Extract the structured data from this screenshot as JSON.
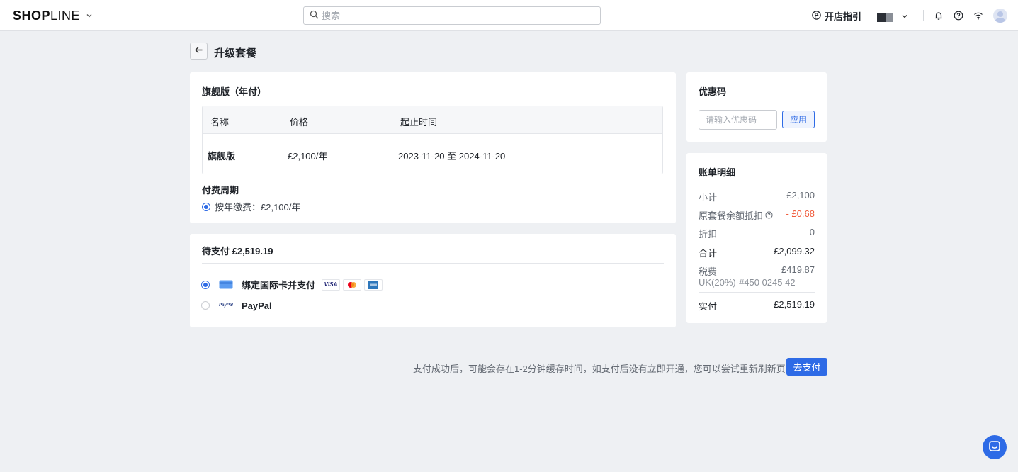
{
  "header": {
    "logo_bold_1": "SH",
    "logo_bold_2": "OP",
    "logo_thin": "LINE",
    "search_placeholder": "搜索",
    "guide_label": "开店指引"
  },
  "page": {
    "title": "升级套餐"
  },
  "plan": {
    "title": "旗舰版（年付）",
    "columns": [
      "名称",
      "价格",
      "起止时间"
    ],
    "row": {
      "name": "旗舰版",
      "price": "£2,100/年",
      "period": "2023-11-20 至 2024-11-20"
    },
    "cycle_title": "付费周期",
    "cycle_option": "按年缴费：£2,100/年"
  },
  "payment": {
    "title": "待支付 £2,519.19",
    "methods": [
      {
        "label": "绑定国际卡并支付",
        "selected": true
      },
      {
        "label": "PayPal",
        "selected": false
      }
    ],
    "card_brands": [
      "VISA",
      "mastercard",
      "amex"
    ],
    "paypal_logo": "PayPal"
  },
  "coupon": {
    "title": "优惠码",
    "placeholder": "请输入优惠码",
    "apply_label": "应用"
  },
  "bill": {
    "title": "账单明细",
    "rows": [
      {
        "label": "小计",
        "value": "£2,100"
      },
      {
        "label": "原套餐余额抵扣",
        "value": "- £0.68"
      },
      {
        "label": "折扣",
        "value": "0"
      },
      {
        "label": "合计",
        "value": "£2,099.32"
      },
      {
        "label": "税费",
        "value": "£419.87"
      }
    ],
    "tax_note": "UK(20%)-#450 0245 42",
    "total_label": "实付",
    "total_value": "£2,519.19"
  },
  "footer": {
    "note": "支付成功后，可能会存在1-2分钟缓存时间，如支付后没有立即开通，您可以尝试重新刷新页面。",
    "pay_label": "去支付"
  },
  "colors": {
    "accent": "#2e6be6",
    "negative": "#f05a3a",
    "background": "#eef0f3"
  }
}
